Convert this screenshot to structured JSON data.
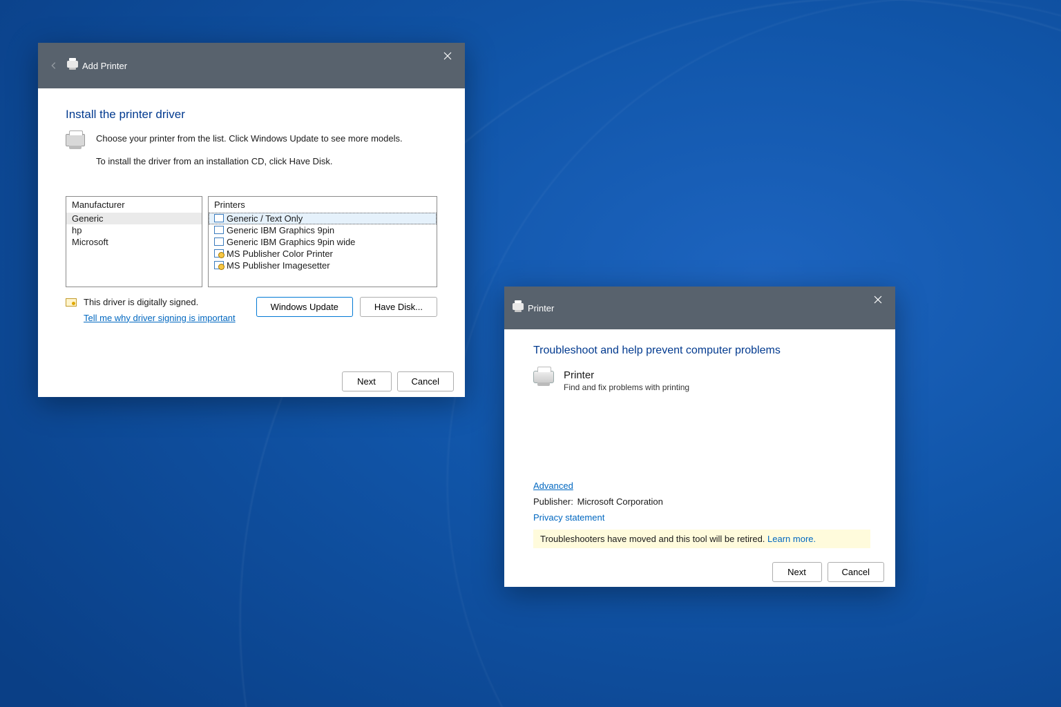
{
  "addPrinter": {
    "title": "Add Printer",
    "heading": "Install the printer driver",
    "instruction1": "Choose your printer from the list. Click Windows Update to see more models.",
    "instruction2": "To install the driver from an installation CD, click Have Disk.",
    "mfrHeader": "Manufacturer",
    "manufacturers": [
      "Generic",
      "hp",
      "Microsoft"
    ],
    "prnHeader": "Printers",
    "printers": [
      "Generic / Text Only",
      "Generic IBM Graphics 9pin",
      "Generic IBM Graphics 9pin wide",
      "MS Publisher Color Printer",
      "MS Publisher Imagesetter"
    ],
    "signedText": "This driver is digitally signed.",
    "signingLink": "Tell me why driver signing is important",
    "btnUpdate": "Windows Update",
    "btnDisk": "Have Disk...",
    "btnNext": "Next",
    "btnCancel": "Cancel"
  },
  "troubleshoot": {
    "title": "Printer",
    "heading": "Troubleshoot and help prevent computer problems",
    "itemTitle": "Printer",
    "itemSub": "Find and fix problems with printing",
    "advanced": "Advanced",
    "publisherLabel": "Publisher:",
    "publisherValue": "Microsoft Corporation",
    "privacy": "Privacy statement",
    "noticeText": "Troubleshooters have moved and this tool will be retired. ",
    "noticeLink": "Learn more.",
    "btnNext": "Next",
    "btnCancel": "Cancel"
  }
}
